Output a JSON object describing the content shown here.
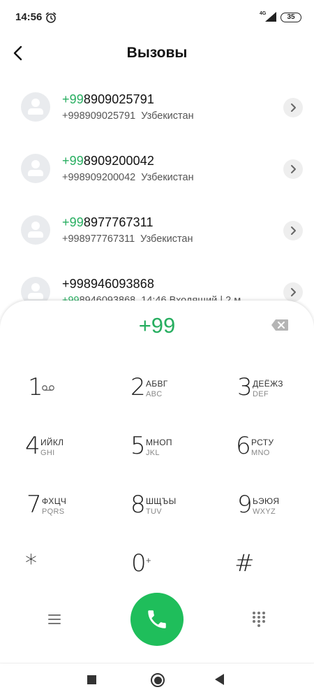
{
  "status_bar": {
    "time": "14:56",
    "network": "4G",
    "battery": "35"
  },
  "header": {
    "title": "Вызовы"
  },
  "calls": [
    {
      "number_match": "+99",
      "number_rest": "8909025791",
      "sub_match": "",
      "sub_rest": "+998909025791",
      "location": "Узбекистан"
    },
    {
      "number_match": "+99",
      "number_rest": "8909200042",
      "sub_match": "",
      "sub_rest": "+998909200042",
      "location": "Узбекистан"
    },
    {
      "number_match": "+99",
      "number_rest": "8977767311",
      "sub_match": "",
      "sub_rest": "+998977767311",
      "location": "Узбекистан"
    },
    {
      "number_match": "",
      "number_rest": "+998946093868",
      "sub_match": "+99",
      "sub_rest": "8946093868",
      "location": "14:46 Входящий | 2 м"
    }
  ],
  "dialpad": {
    "display": "+99",
    "keys": [
      {
        "digit": "1",
        "letters": "",
        "latin": ""
      },
      {
        "digit": "2",
        "letters": "АБВГ",
        "latin": "ABC"
      },
      {
        "digit": "3",
        "letters": "ДЕЁЖЗ",
        "latin": "DEF"
      },
      {
        "digit": "4",
        "letters": "ИЙКЛ",
        "latin": "GHI"
      },
      {
        "digit": "5",
        "letters": "МНОП",
        "latin": "JKL"
      },
      {
        "digit": "6",
        "letters": "РСТУ",
        "latin": "MNO"
      },
      {
        "digit": "7",
        "letters": "ФХЦЧ",
        "latin": "PQRS"
      },
      {
        "digit": "8",
        "letters": "ШЩЪЫ",
        "latin": "TUV"
      },
      {
        "digit": "9",
        "letters": "ЬЭЮЯ",
        "latin": "WXYZ"
      },
      {
        "digit": "*",
        "letters": "",
        "latin": ""
      },
      {
        "digit": "0",
        "letters": "+",
        "latin": ""
      },
      {
        "digit": "#",
        "letters": "",
        "latin": ""
      }
    ]
  },
  "colors": {
    "accent": "#27ae60",
    "call_button": "#1fbe5b"
  },
  "icons": {
    "alarm": "alarm-clock-icon",
    "back": "chevron-left-icon",
    "avatar": "person-icon",
    "detail": "chevron-right-icon",
    "backspace": "backspace-icon",
    "voicemail": "voicemail-icon",
    "menu": "menu-icon",
    "call": "phone-icon",
    "keypad": "dialpad-icon"
  }
}
